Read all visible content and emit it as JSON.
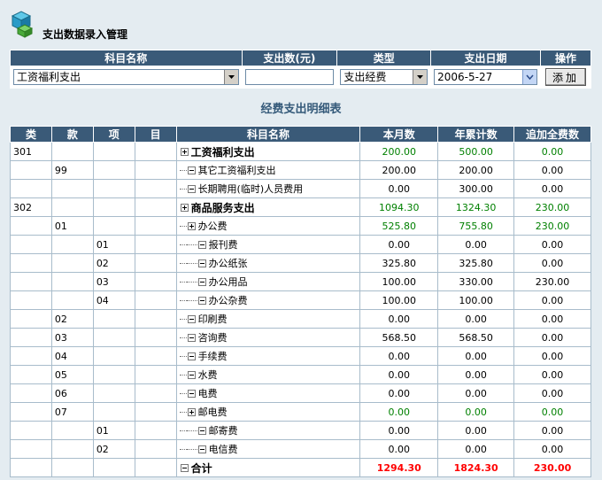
{
  "header": {
    "title": "支出数据录入管理",
    "logo_icon": "cube-stack-icon"
  },
  "entry": {
    "columns": [
      "科目名称",
      "支出数(元)",
      "类型",
      "支出日期",
      "操作"
    ],
    "subject_value": "工资福利支出",
    "amount_value": "",
    "type_value": "支出经费",
    "date_value": "2006-5-27",
    "add_label": "添加"
  },
  "detail": {
    "title": "经费支出明细表",
    "columns": [
      "类",
      "款",
      "项",
      "目",
      "科目名称",
      "本月数",
      "年累计数",
      "追加全费数"
    ],
    "rows": [
      {
        "lei": "301",
        "kuan": "",
        "xiang": "",
        "mu": "",
        "name": "工资福利支出",
        "month": "200.00",
        "year": "500.00",
        "extra": "0.00"
      },
      {
        "lei": "",
        "kuan": "99",
        "xiang": "",
        "mu": "",
        "name": "其它工资福利支出",
        "month": "200.00",
        "year": "200.00",
        "extra": "0.00"
      },
      {
        "lei": "",
        "kuan": "",
        "xiang": "",
        "mu": "",
        "name": "长期聘用(临时)人员费用",
        "month": "0.00",
        "year": "300.00",
        "extra": "0.00"
      },
      {
        "lei": "302",
        "kuan": "",
        "xiang": "",
        "mu": "",
        "name": "商品服务支出",
        "month": "1094.30",
        "year": "1324.30",
        "extra": "230.00"
      },
      {
        "lei": "",
        "kuan": "01",
        "xiang": "",
        "mu": "",
        "name": "办公费",
        "month": "525.80",
        "year": "755.80",
        "extra": "230.00"
      },
      {
        "lei": "",
        "kuan": "",
        "xiang": "01",
        "mu": "",
        "name": "报刊费",
        "month": "0.00",
        "year": "0.00",
        "extra": "0.00"
      },
      {
        "lei": "",
        "kuan": "",
        "xiang": "02",
        "mu": "",
        "name": "办公纸张",
        "month": "325.80",
        "year": "325.80",
        "extra": "0.00"
      },
      {
        "lei": "",
        "kuan": "",
        "xiang": "03",
        "mu": "",
        "name": "办公用品",
        "month": "100.00",
        "year": "330.00",
        "extra": "230.00"
      },
      {
        "lei": "",
        "kuan": "",
        "xiang": "04",
        "mu": "",
        "name": "办公杂费",
        "month": "100.00",
        "year": "100.00",
        "extra": "0.00"
      },
      {
        "lei": "",
        "kuan": "02",
        "xiang": "",
        "mu": "",
        "name": "印刷费",
        "month": "0.00",
        "year": "0.00",
        "extra": "0.00"
      },
      {
        "lei": "",
        "kuan": "03",
        "xiang": "",
        "mu": "",
        "name": "咨询费",
        "month": "568.50",
        "year": "568.50",
        "extra": "0.00"
      },
      {
        "lei": "",
        "kuan": "04",
        "xiang": "",
        "mu": "",
        "name": "手续费",
        "month": "0.00",
        "year": "0.00",
        "extra": "0.00"
      },
      {
        "lei": "",
        "kuan": "05",
        "xiang": "",
        "mu": "",
        "name": "水费",
        "month": "0.00",
        "year": "0.00",
        "extra": "0.00"
      },
      {
        "lei": "",
        "kuan": "06",
        "xiang": "",
        "mu": "",
        "name": "电费",
        "month": "0.00",
        "year": "0.00",
        "extra": "0.00"
      },
      {
        "lei": "",
        "kuan": "07",
        "xiang": "",
        "mu": "",
        "name": "邮电费",
        "month": "0.00",
        "year": "0.00",
        "extra": "0.00"
      },
      {
        "lei": "",
        "kuan": "",
        "xiang": "01",
        "mu": "",
        "name": "邮寄费",
        "month": "0.00",
        "year": "0.00",
        "extra": "0.00"
      },
      {
        "lei": "",
        "kuan": "",
        "xiang": "02",
        "mu": "",
        "name": "电信费",
        "month": "0.00",
        "year": "0.00",
        "extra": "0.00"
      }
    ],
    "total": {
      "name": "合计",
      "month": "1294.30",
      "year": "1824.30",
      "extra": "230.00"
    }
  },
  "colors": {
    "header_bg": "#3a5a78",
    "page_bg": "#e4ecf1",
    "highlight_value": "#008000",
    "total_value": "#ff0000"
  }
}
